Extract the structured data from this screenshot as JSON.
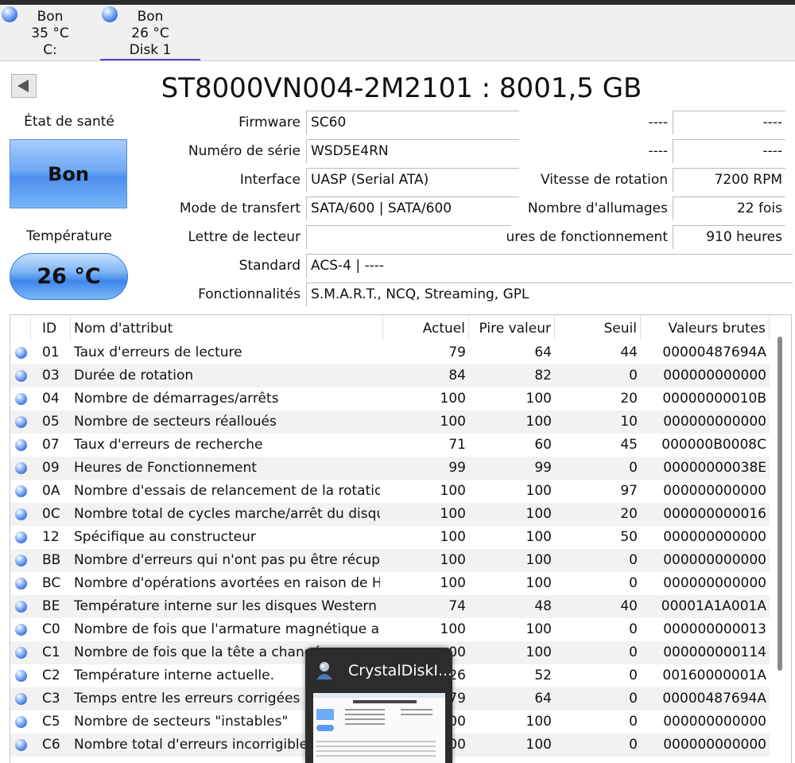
{
  "disk_tabs": [
    {
      "status": "Bon",
      "temp": "35 °C",
      "name": "C:",
      "active": false
    },
    {
      "status": "Bon",
      "temp": "26 °C",
      "name": "Disk 1",
      "active": true
    }
  ],
  "disk_title": "ST8000VN004-2M2101 : 8001,5 GB",
  "health": {
    "label": "État de santé",
    "value": "Bon"
  },
  "temperature": {
    "label": "Température",
    "value": "26 °C"
  },
  "fields": [
    {
      "label": "Firmware",
      "value": "SC60"
    },
    {
      "label": "Numéro de série",
      "value": "WSD5E4RN"
    },
    {
      "label": "Interface",
      "value": "UASP (Serial ATA)"
    },
    {
      "label": "Mode de transfert",
      "value": "SATA/600 | SATA/600"
    },
    {
      "label": "Lettre de lecteur",
      "value": ""
    },
    {
      "label": "Standard",
      "value": "ACS-4 | ----"
    },
    {
      "label": "Fonctionnalités",
      "value": "S.M.A.R.T., NCQ, Streaming, GPL"
    }
  ],
  "right_fields": [
    {
      "label": "----",
      "value": "----"
    },
    {
      "label": "----",
      "value": "----"
    },
    {
      "label": "Vitesse de rotation",
      "value": "7200 RPM"
    },
    {
      "label": "Nombre d'allumages",
      "value": "22 fois"
    },
    {
      "label": "ures de fonctionnement",
      "value": "910 heures"
    }
  ],
  "table": {
    "headers": {
      "id": "ID",
      "name": "Nom d'attribut",
      "current": "Actuel",
      "worst": "Pire valeur",
      "threshold": "Seuil",
      "raw": "Valeurs brutes"
    },
    "rows": [
      {
        "id": "01",
        "name": "Taux d'erreurs de lecture",
        "current": "79",
        "worst": "64",
        "threshold": "44",
        "raw": "00000487694A"
      },
      {
        "id": "03",
        "name": "Durée de rotation",
        "current": "84",
        "worst": "82",
        "threshold": "0",
        "raw": "000000000000"
      },
      {
        "id": "04",
        "name": "Nombre de démarrages/arrêts",
        "current": "100",
        "worst": "100",
        "threshold": "20",
        "raw": "00000000010B"
      },
      {
        "id": "05",
        "name": "Nombre de secteurs réalloués",
        "current": "100",
        "worst": "100",
        "threshold": "10",
        "raw": "000000000000"
      },
      {
        "id": "07",
        "name": "Taux d'erreurs de recherche",
        "current": "71",
        "worst": "60",
        "threshold": "45",
        "raw": "000000B0008C"
      },
      {
        "id": "09",
        "name": "Heures de Fonctionnement",
        "current": "99",
        "worst": "99",
        "threshold": "0",
        "raw": "00000000038E"
      },
      {
        "id": "0A",
        "name": "Nombre d'essais de relancement de la rotation",
        "current": "100",
        "worst": "100",
        "threshold": "97",
        "raw": "000000000000"
      },
      {
        "id": "0C",
        "name": "Nombre total de cycles marche/arrêt du disqu...",
        "current": "100",
        "worst": "100",
        "threshold": "20",
        "raw": "000000000016"
      },
      {
        "id": "12",
        "name": "Spécifique au constructeur",
        "current": "100",
        "worst": "100",
        "threshold": "50",
        "raw": "000000000000"
      },
      {
        "id": "BB",
        "name": "Nombre d'erreurs qui n'ont pas pu être récupé...",
        "current": "100",
        "worst": "100",
        "threshold": "0",
        "raw": "000000000000"
      },
      {
        "id": "BC",
        "name": "Nombre d'opérations avortées en raison de H...",
        "current": "100",
        "worst": "100",
        "threshold": "0",
        "raw": "000000000000"
      },
      {
        "id": "BE",
        "name": "Température interne sur les disques Western Di...",
        "current": "74",
        "worst": "48",
        "threshold": "40",
        "raw": "00001A1A001A"
      },
      {
        "id": "C0",
        "name": "Nombre de fois que l'armature magnétique a ...",
        "current": "100",
        "worst": "100",
        "threshold": "0",
        "raw": "000000000013"
      },
      {
        "id": "C1",
        "name": "Nombre de fois que la tête a changé",
        "current": "00",
        "worst": "100",
        "threshold": "0",
        "raw": "000000000114"
      },
      {
        "id": "C2",
        "name": "Température interne actuelle.",
        "current": "26",
        "worst": "52",
        "threshold": "0",
        "raw": "00160000001A"
      },
      {
        "id": "C3",
        "name": "Temps entre les erreurs corrigées par",
        "current": "79",
        "worst": "64",
        "threshold": "0",
        "raw": "00000487694A"
      },
      {
        "id": "C5",
        "name": "Nombre de secteurs \"instables\"",
        "current": "00",
        "worst": "100",
        "threshold": "0",
        "raw": "000000000000"
      },
      {
        "id": "C6",
        "name": "Nombre total d'erreurs incorrigibles d",
        "current": "00",
        "worst": "100",
        "threshold": "0",
        "raw": "000000000000"
      }
    ]
  },
  "taskbar_preview": {
    "title": "CrystalDiskI..."
  }
}
